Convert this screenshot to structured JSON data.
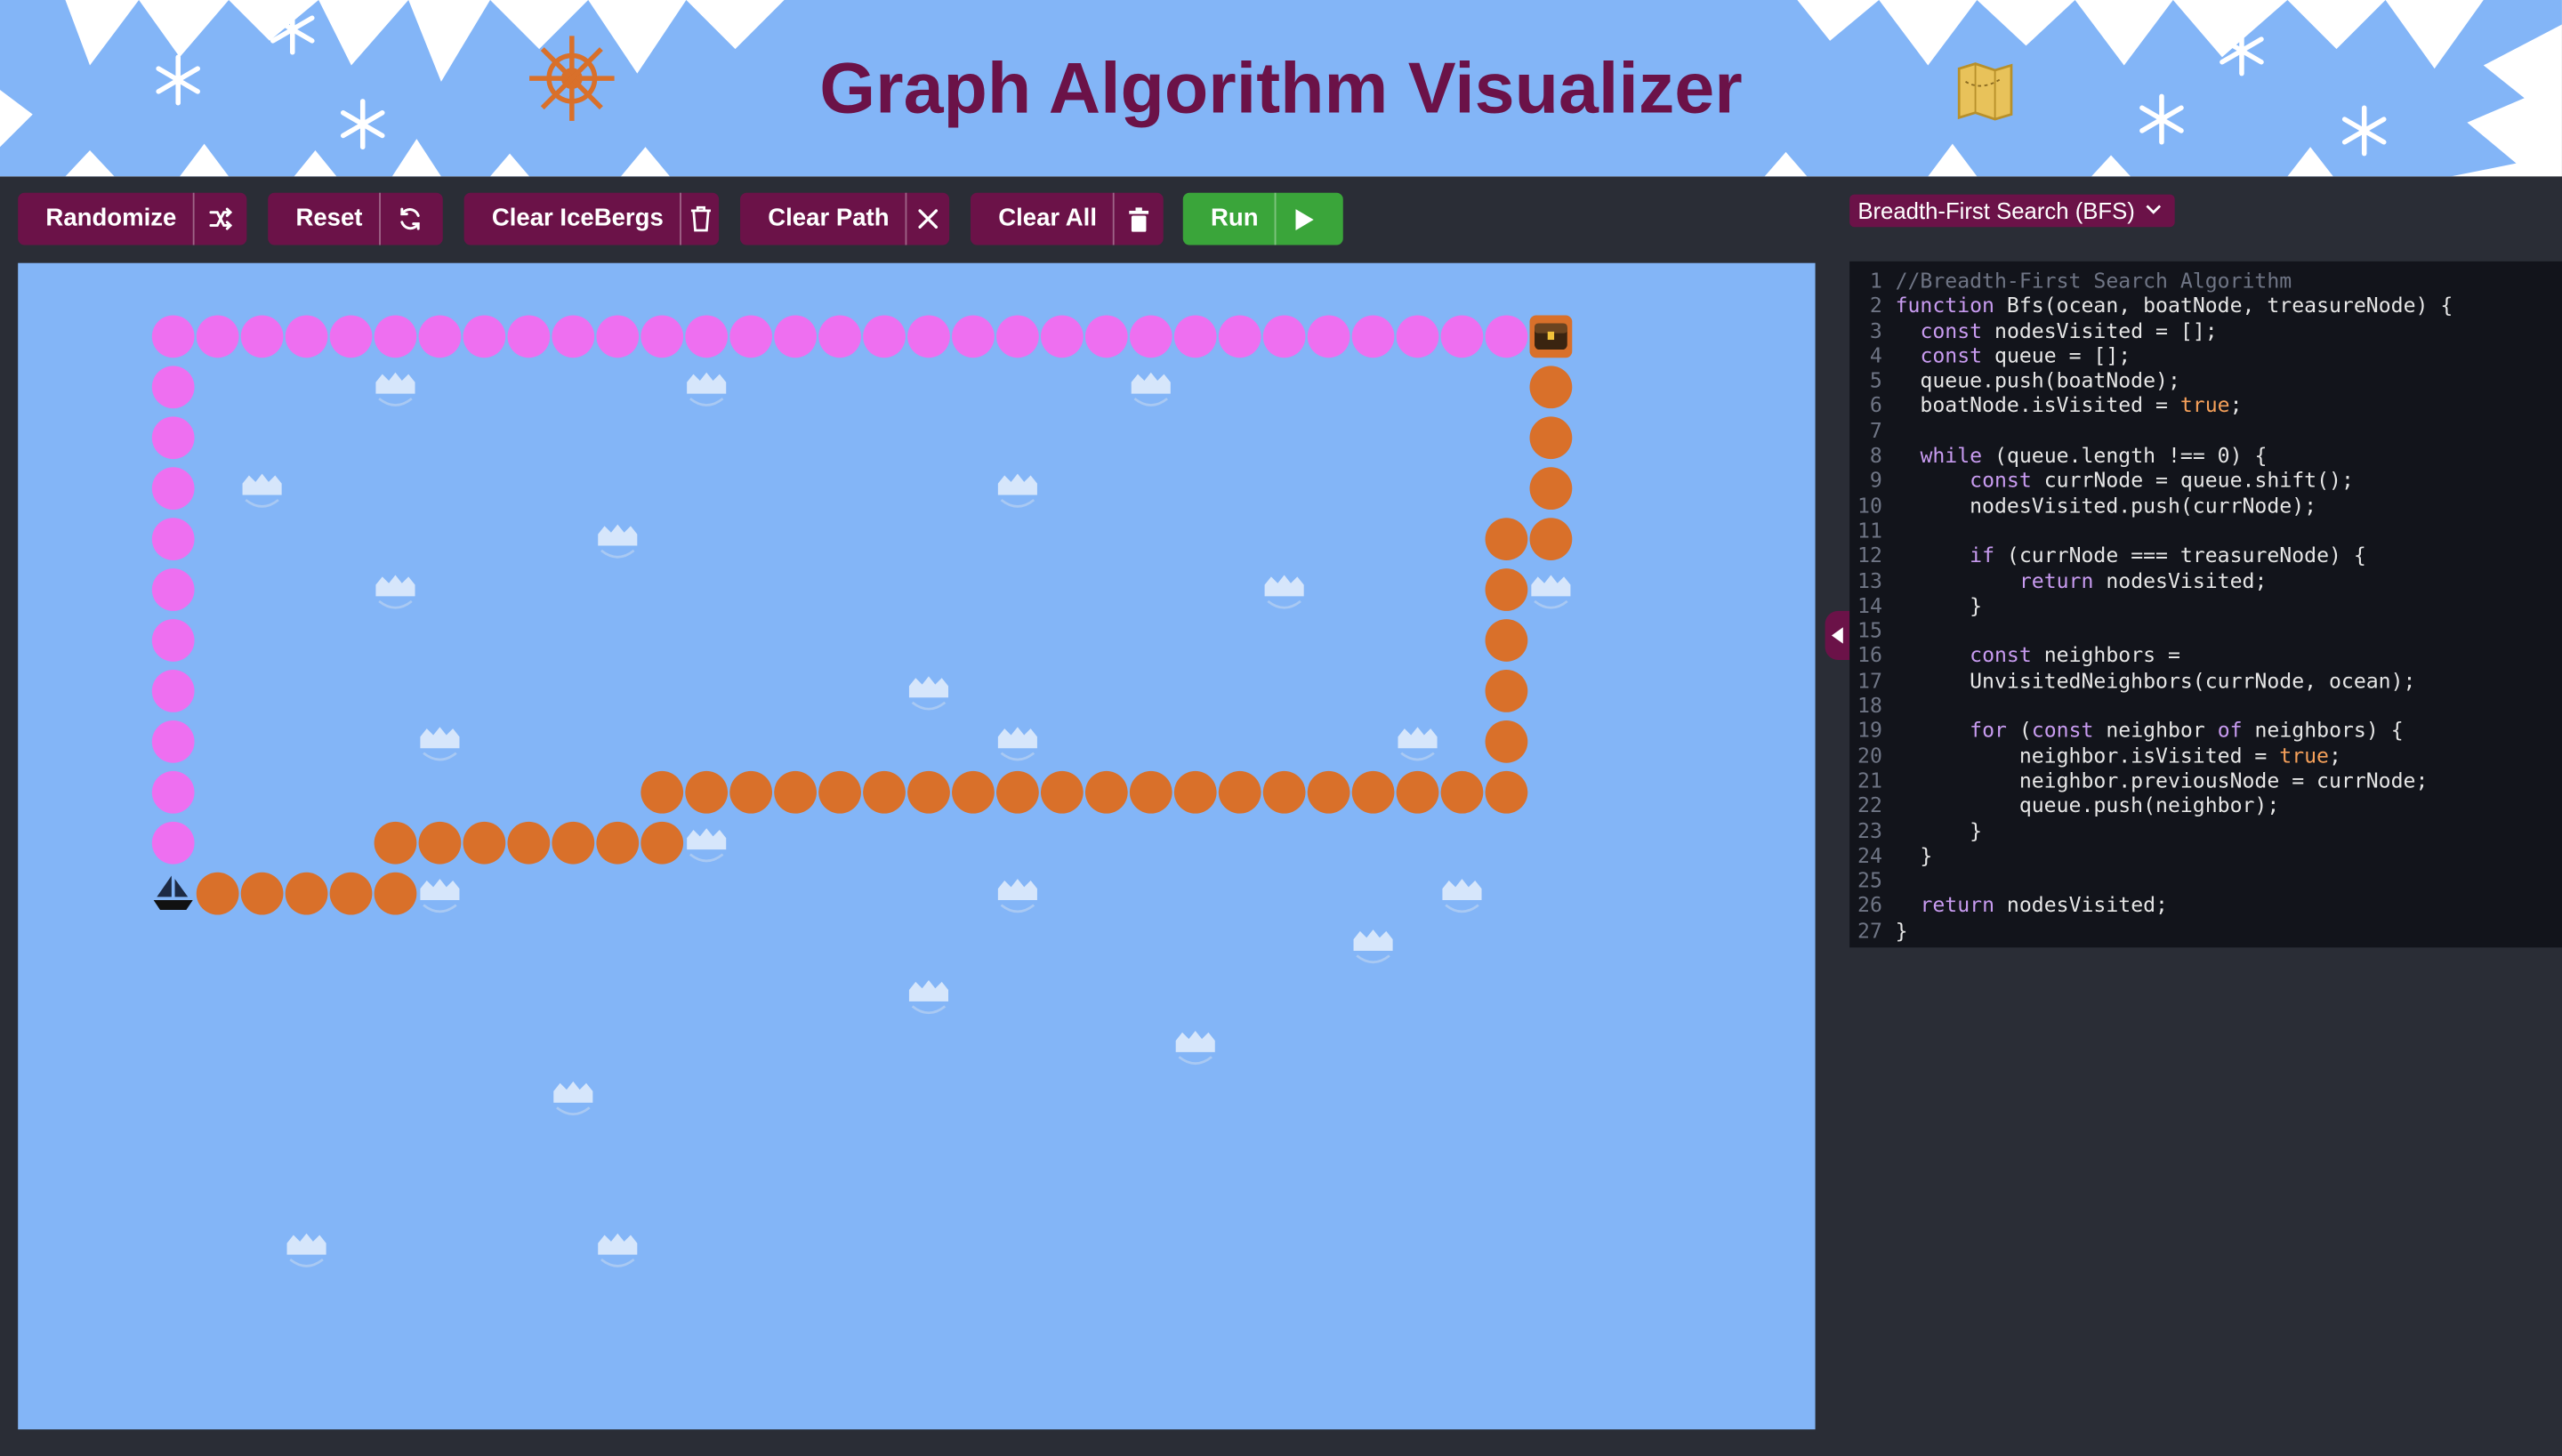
{
  "header": {
    "title": "Graph Algorithm Visualizer"
  },
  "toolbar": {
    "randomize": "Randomize",
    "reset": "Reset",
    "clear_icebergs": "Clear IceBergs",
    "clear_path": "Clear Path",
    "clear_all": "Clear All",
    "run": "Run"
  },
  "algorithm_select": {
    "selected": "Breadth-First Search (BFS)"
  },
  "code_editor": {
    "lines": [
      "//Breadth-First Search Algorithm",
      "function Bfs(ocean, boatNode, treasureNode) {",
      "  const nodesVisited = [];",
      "  const queue = [];",
      "  queue.push(boatNode);",
      "  boatNode.isVisited = true;",
      "",
      "  while (queue.length !== 0) {",
      "      const currNode = queue.shift();",
      "      nodesVisited.push(currNode);",
      "",
      "      if (currNode === treasureNode) {",
      "          return nodesVisited;",
      "      }",
      "",
      "      const neighbors =",
      "      UnvisitedNeighbors(currNode, ocean);",
      "",
      "      for (const neighbor of neighbors) {",
      "          neighbor.isVisited = true;",
      "          neighbor.previousNode = currNode;",
      "          queue.push(neighbor);",
      "      }",
      "  }",
      "",
      "  return nodesVisited;",
      "}"
    ]
  },
  "colors": {
    "brand": "#6b1248",
    "run": "#3aa53a",
    "ocean": "#83b5f7",
    "visited": "#ee6ff0",
    "path": "#d9702a",
    "iceberg": "#d6e6fb"
  },
  "grid": {
    "icons": [
      "boat-icon",
      "treasure-chest-icon",
      "iceberg-icon"
    ]
  }
}
